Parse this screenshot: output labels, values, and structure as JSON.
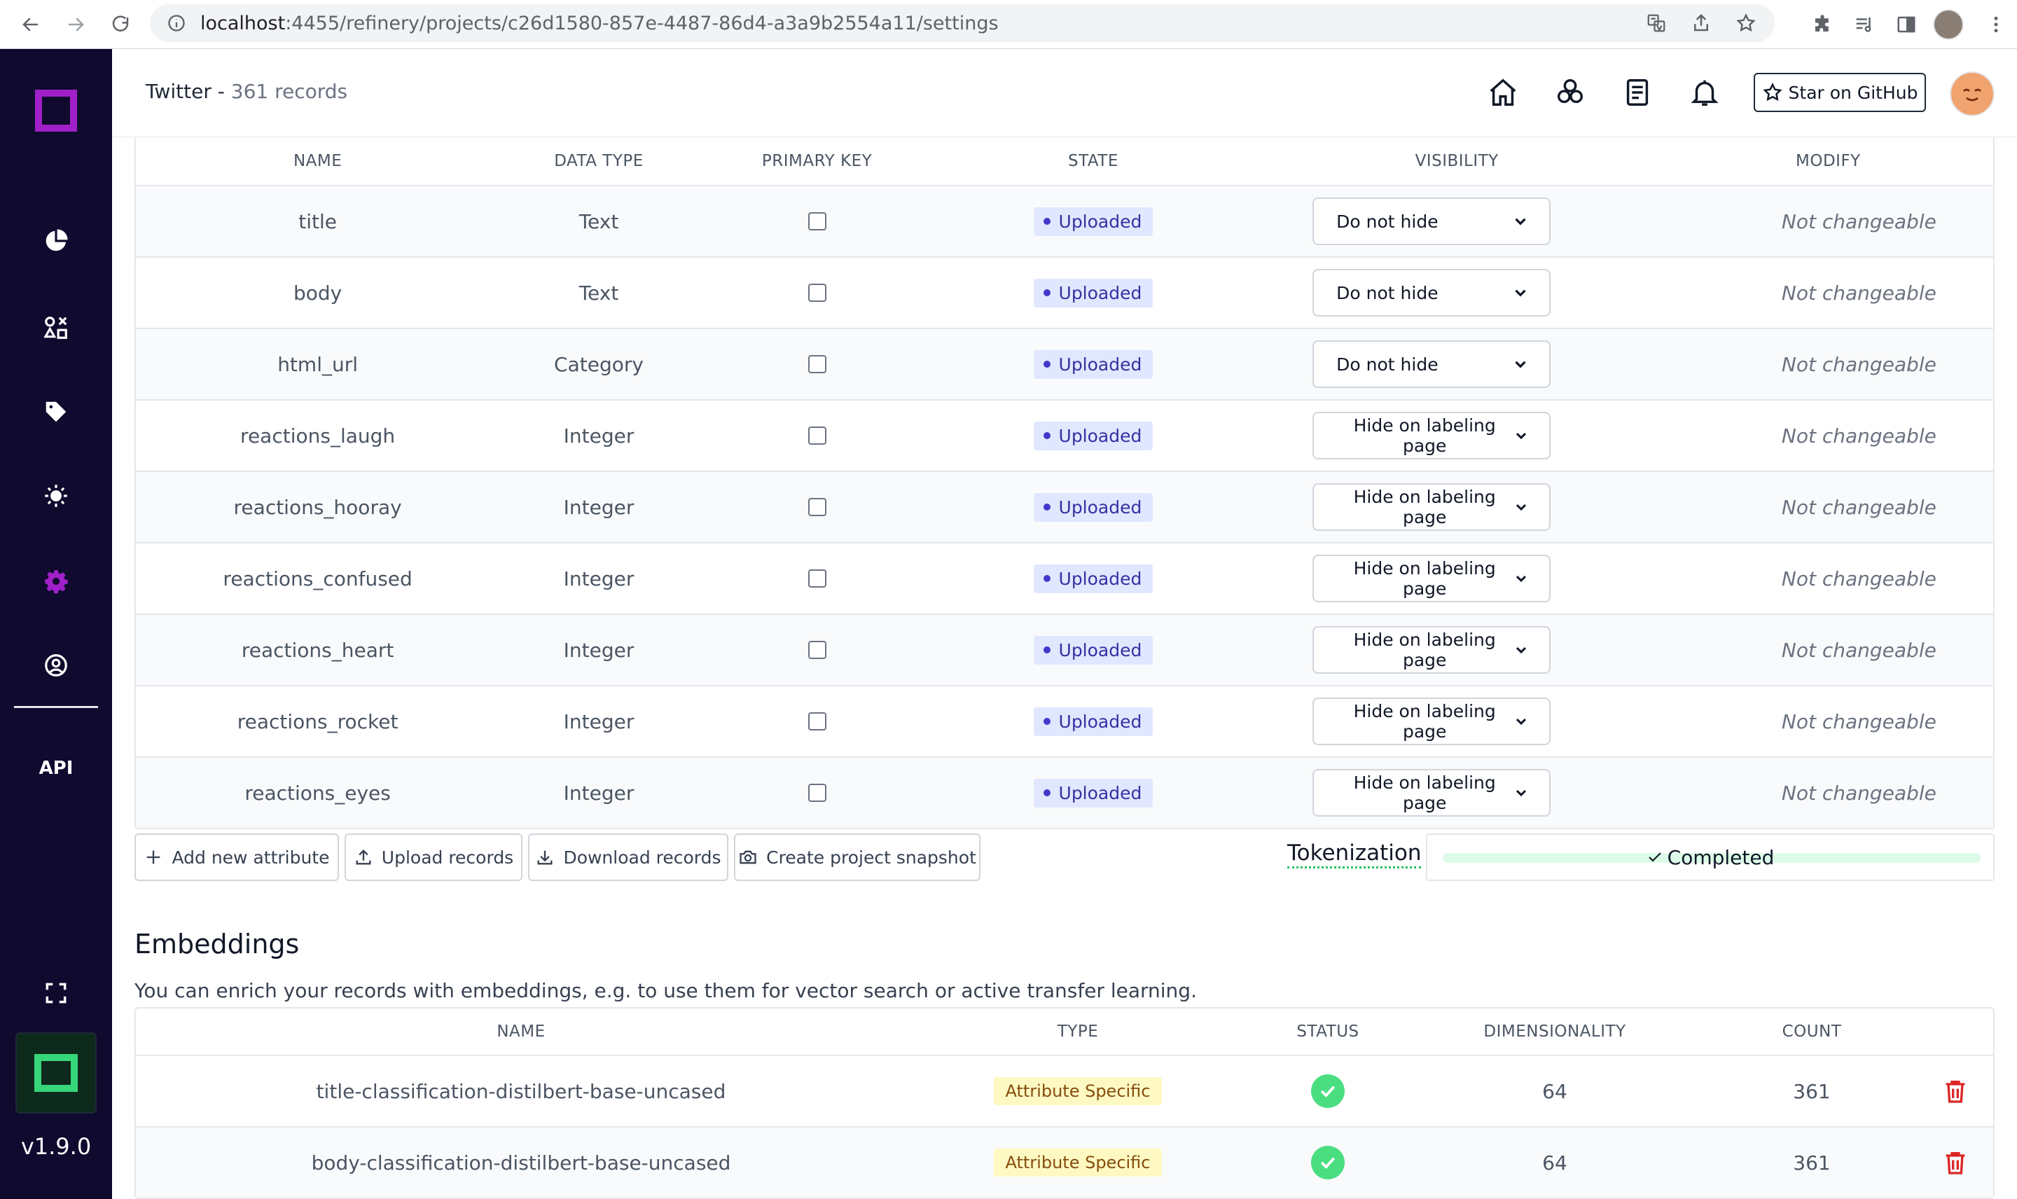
{
  "browser": {
    "url_host": "localhost",
    "url_rest": ":4455/refinery/projects/c26d1580-857e-4487-86d4-a3a9b2554a11/settings"
  },
  "sidebar": {
    "api_label": "API",
    "version": "v1.9.0",
    "accent_color": "#a020c8"
  },
  "header": {
    "project_name": "Twitter",
    "separator": " - ",
    "record_count": "361 records",
    "star_button": "Star on GitHub"
  },
  "attributes_table": {
    "columns": [
      "NAME",
      "DATA TYPE",
      "PRIMARY KEY",
      "STATE",
      "VISIBILITY",
      "MODIFY"
    ],
    "rows": [
      {
        "name": "title",
        "data_type": "Text",
        "primary_key": false,
        "state": "Uploaded",
        "visibility": "Do not hide",
        "modify": "Not changeable"
      },
      {
        "name": "body",
        "data_type": "Text",
        "primary_key": false,
        "state": "Uploaded",
        "visibility": "Do not hide",
        "modify": "Not changeable"
      },
      {
        "name": "html_url",
        "data_type": "Category",
        "primary_key": false,
        "state": "Uploaded",
        "visibility": "Do not hide",
        "modify": "Not changeable"
      },
      {
        "name": "reactions_laugh",
        "data_type": "Integer",
        "primary_key": false,
        "state": "Uploaded",
        "visibility": "Hide on labeling page",
        "modify": "Not changeable"
      },
      {
        "name": "reactions_hooray",
        "data_type": "Integer",
        "primary_key": false,
        "state": "Uploaded",
        "visibility": "Hide on labeling page",
        "modify": "Not changeable"
      },
      {
        "name": "reactions_confused",
        "data_type": "Integer",
        "primary_key": false,
        "state": "Uploaded",
        "visibility": "Hide on labeling page",
        "modify": "Not changeable"
      },
      {
        "name": "reactions_heart",
        "data_type": "Integer",
        "primary_key": false,
        "state": "Uploaded",
        "visibility": "Hide on labeling page",
        "modify": "Not changeable"
      },
      {
        "name": "reactions_rocket",
        "data_type": "Integer",
        "primary_key": false,
        "state": "Uploaded",
        "visibility": "Hide on labeling page",
        "modify": "Not changeable"
      },
      {
        "name": "reactions_eyes",
        "data_type": "Integer",
        "primary_key": false,
        "state": "Uploaded",
        "visibility": "Hide on labeling page",
        "modify": "Not changeable"
      }
    ]
  },
  "actions": {
    "add_attribute": "Add new attribute",
    "upload_records": "Upload records",
    "download_records": "Download records",
    "create_snapshot": "Create project snapshot",
    "tokenization_label": "Tokenization",
    "tokenization_status": "Completed",
    "tokenization_progress": 1.0
  },
  "embeddings": {
    "title": "Embeddings",
    "description": "You can enrich your records with embeddings, e.g. to use them for vector search or active transfer learning.",
    "columns": [
      "NAME",
      "TYPE",
      "STATUS",
      "DIMENSIONALITY",
      "COUNT"
    ],
    "rows": [
      {
        "name": "title-classification-distilbert-base-uncased",
        "type": "Attribute Specific",
        "status": "finished",
        "dimensionality": "64",
        "count": "361"
      },
      {
        "name": "body-classification-distilbert-base-uncased",
        "type": "Attribute Specific",
        "status": "finished",
        "dimensionality": "64",
        "count": "361"
      }
    ]
  }
}
